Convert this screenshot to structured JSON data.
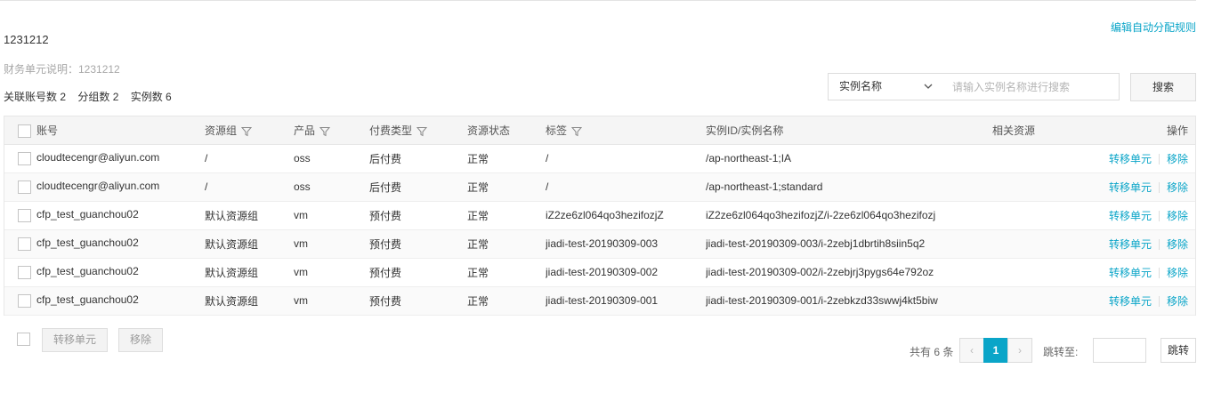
{
  "header": {
    "edit_rule_link": "编辑自动分配规则",
    "unit_name": "1231212",
    "unit_desc": "财务单元说明：1231212",
    "stats": {
      "accounts": "关联账号数 2",
      "groups": "分组数 2",
      "instances": "实例数 6"
    }
  },
  "search": {
    "select_value": "实例名称",
    "placeholder": "请输入实例名称进行搜索",
    "button": "搜索"
  },
  "table": {
    "columns": {
      "account": "账号",
      "resource_group": "资源组",
      "product": "产品",
      "billing_type": "付费类型",
      "status": "资源状态",
      "tag": "标签",
      "instance": "实例ID/实例名称",
      "related": "相关资源",
      "actions": "操作"
    },
    "action_labels": {
      "transfer": "转移单元",
      "remove": "移除"
    },
    "rows": [
      {
        "account": "cloudtecengr@aliyun.com",
        "resource_group": "/",
        "product": "oss",
        "billing_type": "后付费",
        "status": "正常",
        "tag": "/",
        "instance": "/ap-northeast-1;IA",
        "related": ""
      },
      {
        "account": "cloudtecengr@aliyun.com",
        "resource_group": "/",
        "product": "oss",
        "billing_type": "后付费",
        "status": "正常",
        "tag": "/",
        "instance": "/ap-northeast-1;standard",
        "related": ""
      },
      {
        "account": "cfp_test_guanchou02",
        "resource_group": "默认资源组",
        "product": "vm",
        "billing_type": "预付费",
        "status": "正常",
        "tag": "iZ2ze6zl064qo3hezifozjZ",
        "instance": "iZ2ze6zl064qo3hezifozjZ/i-2ze6zl064qo3hezifozj",
        "related": ""
      },
      {
        "account": "cfp_test_guanchou02",
        "resource_group": "默认资源组",
        "product": "vm",
        "billing_type": "预付费",
        "status": "正常",
        "tag": "jiadi-test-20190309-003",
        "instance": "jiadi-test-20190309-003/i-2zebj1dbrtih8siin5q2",
        "related": ""
      },
      {
        "account": "cfp_test_guanchou02",
        "resource_group": "默认资源组",
        "product": "vm",
        "billing_type": "预付费",
        "status": "正常",
        "tag": "jiadi-test-20190309-002",
        "instance": "jiadi-test-20190309-002/i-2zebjrj3pygs64e792oz",
        "related": ""
      },
      {
        "account": "cfp_test_guanchou02",
        "resource_group": "默认资源组",
        "product": "vm",
        "billing_type": "预付费",
        "status": "正常",
        "tag": "jiadi-test-20190309-001",
        "instance": "jiadi-test-20190309-001/i-2zebkzd33swwj4kt5biw",
        "related": ""
      }
    ]
  },
  "footer": {
    "transfer_button": "转移单元",
    "remove_button": "移除",
    "total": "共有 6 条",
    "prev": "‹",
    "current_page": "1",
    "next": "›",
    "jump_label": "跳转至:",
    "jump_button": "跳转"
  },
  "colors": {
    "accent": "#0aa5c8",
    "header_bg": "#f5f5f5",
    "border": "#e7e7e7"
  },
  "icons": {
    "filter": "filter-icon",
    "dropdown": "chevron-down-icon"
  }
}
